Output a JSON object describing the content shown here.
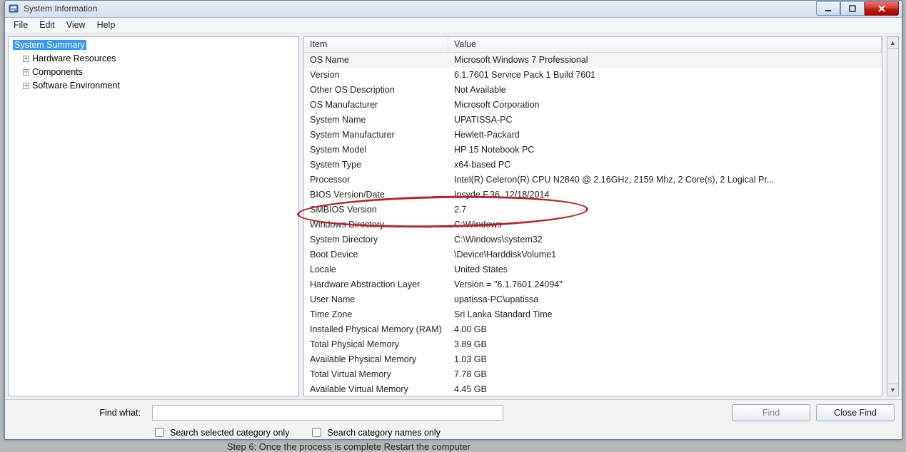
{
  "window": {
    "title": "System Information"
  },
  "menu": {
    "file": "File",
    "edit": "Edit",
    "view": "View",
    "help": "Help"
  },
  "tree": {
    "root": "System Summary",
    "children": [
      "Hardware Resources",
      "Components",
      "Software Environment"
    ]
  },
  "columns": {
    "item": "Item",
    "value": "Value"
  },
  "rows": [
    {
      "item": "OS Name",
      "value": "Microsoft Windows 7 Professional"
    },
    {
      "item": "Version",
      "value": "6.1.7601 Service Pack 1 Build 7601"
    },
    {
      "item": "Other OS Description",
      "value": "Not Available"
    },
    {
      "item": "OS Manufacturer",
      "value": "Microsoft Corporation"
    },
    {
      "item": "System Name",
      "value": "UPATISSA-PC"
    },
    {
      "item": "System Manufacturer",
      "value": "Hewlett-Packard"
    },
    {
      "item": "System Model",
      "value": "HP 15 Notebook PC"
    },
    {
      "item": "System Type",
      "value": "x64-based PC"
    },
    {
      "item": "Processor",
      "value": "Intel(R) Celeron(R) CPU  N2840  @ 2.16GHz, 2159 Mhz, 2 Core(s), 2 Logical Pr..."
    },
    {
      "item": "BIOS Version/Date",
      "value": "Insyde F.36, 12/18/2014"
    },
    {
      "item": "SMBIOS Version",
      "value": "2.7"
    },
    {
      "item": "Windows Directory",
      "value": "C:\\Windows"
    },
    {
      "item": "System Directory",
      "value": "C:\\Windows\\system32"
    },
    {
      "item": "Boot Device",
      "value": "\\Device\\HarddiskVolume1"
    },
    {
      "item": "Locale",
      "value": "United States"
    },
    {
      "item": "Hardware Abstraction Layer",
      "value": "Version = \"6.1.7601.24094\""
    },
    {
      "item": "User Name",
      "value": "upatissa-PC\\upatissa"
    },
    {
      "item": "Time Zone",
      "value": "Sri Lanka Standard Time"
    },
    {
      "item": "Installed Physical Memory (RAM)",
      "value": "4.00 GB"
    },
    {
      "item": "Total Physical Memory",
      "value": "3.89 GB"
    },
    {
      "item": "Available Physical Memory",
      "value": "1.03 GB"
    },
    {
      "item": "Total Virtual Memory",
      "value": "7.78 GB"
    },
    {
      "item": "Available Virtual Memory",
      "value": "4.45 GB"
    }
  ],
  "find": {
    "label": "Find what:",
    "placeholder": "",
    "value": "",
    "find_btn": "Find",
    "close_btn": "Close Find",
    "chk_category": "Search selected category only",
    "chk_names": "Search category names only"
  },
  "below": "Step 6: Once the process is complete  Restart the computer"
}
